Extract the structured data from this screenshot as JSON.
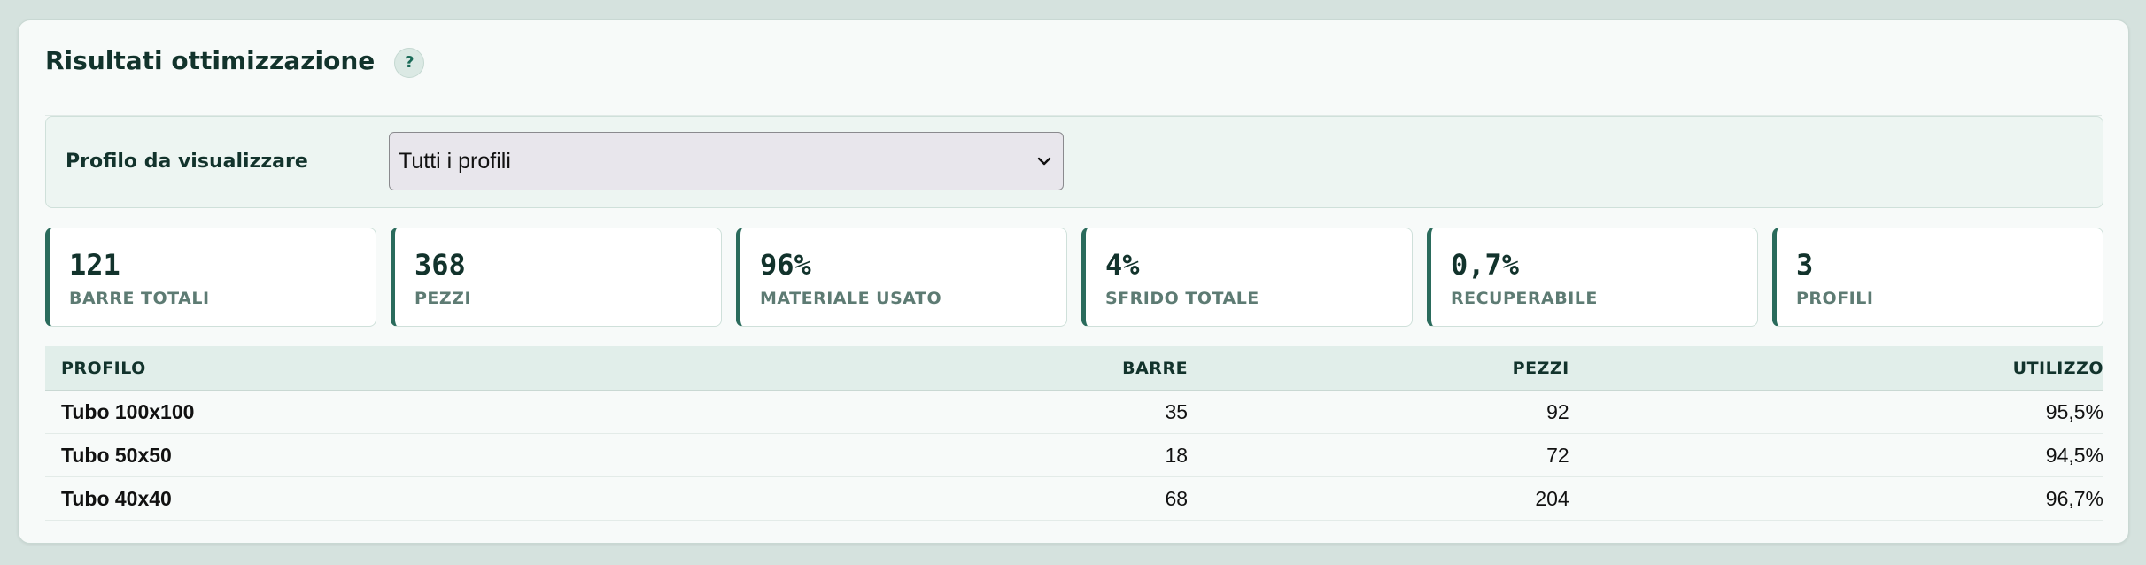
{
  "header": {
    "title": "Risultati ottimizzazione",
    "help_label": "?"
  },
  "filter": {
    "label": "Profilo da visualizzare",
    "selected": "Tutti i profili"
  },
  "stats": [
    {
      "value": "121",
      "label": "BARRE TOTALI"
    },
    {
      "value": "368",
      "label": "PEZZI"
    },
    {
      "value": "96%",
      "label": "MATERIALE USATO"
    },
    {
      "value": "4%",
      "label": "SFRIDO TOTALE"
    },
    {
      "value": "0,7%",
      "label": "RECUPERABILE"
    },
    {
      "value": "3",
      "label": "PROFILI"
    }
  ],
  "table": {
    "columns": [
      "PROFILO",
      "BARRE",
      "PEZZI",
      "UTILIZZO"
    ],
    "rows": [
      {
        "profilo": "Tubo 100x100",
        "barre": "35",
        "pezzi": "92",
        "utilizzo": "95,5%"
      },
      {
        "profilo": "Tubo 50x50",
        "barre": "18",
        "pezzi": "72",
        "utilizzo": "94,5%"
      },
      {
        "profilo": "Tubo 40x40",
        "barre": "68",
        "pezzi": "204",
        "utilizzo": "96,7%"
      }
    ]
  },
  "colors": {
    "accent": "#2a6b5c",
    "text": "#12332c",
    "muted": "#5d7b73",
    "background": "#d5e2de"
  }
}
